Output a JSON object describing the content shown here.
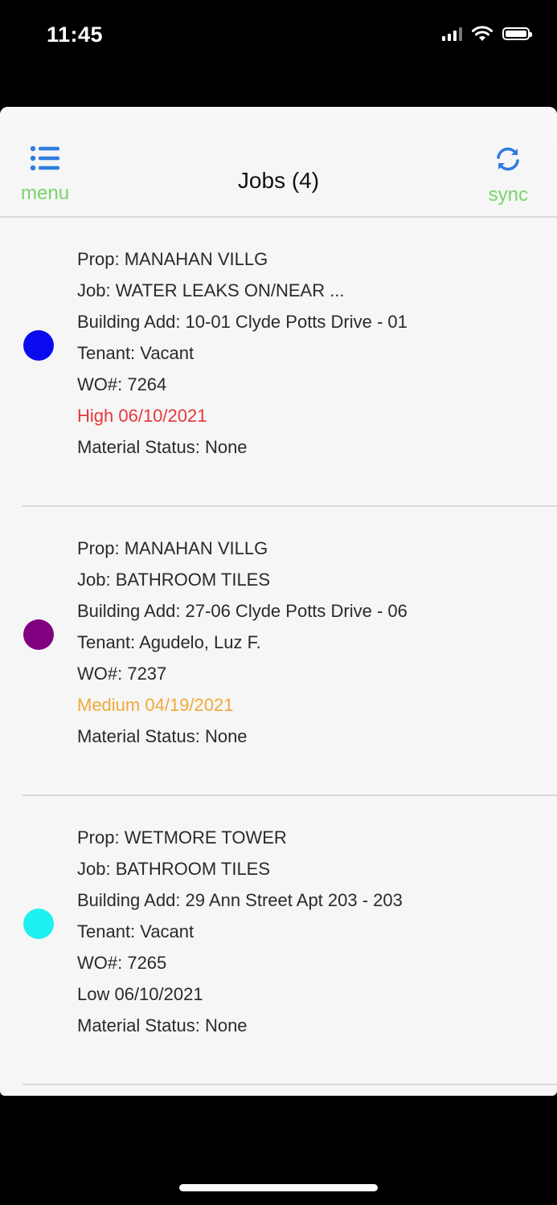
{
  "status_bar": {
    "time": "11:45"
  },
  "navbar": {
    "title": "Jobs (4)",
    "menu_label": "menu",
    "sync_label": "sync",
    "accent_color": "#2f7ce0",
    "label_color": "#78d46a"
  },
  "jobs": [
    {
      "dot_color": "#0a0aef",
      "prop": "Prop: MANAHAN VILLG",
      "job": "Job: WATER LEAKS ON/NEAR ...",
      "building": "Building Add: 10-01 Clyde Potts Drive - 01",
      "tenant": "Tenant: Vacant",
      "wo": "WO#: 7264",
      "priority": "High 06/10/2021",
      "priority_color": "#e8373c",
      "material": "Material Status: None"
    },
    {
      "dot_color": "#800080",
      "prop": "Prop: MANAHAN VILLG",
      "job": "Job: BATHROOM TILES",
      "building": "Building Add: 27-06 Clyde Potts Drive - 06",
      "tenant": "Tenant: Agudelo, Luz F.",
      "wo": "WO#: 7237",
      "priority": "Medium 04/19/2021",
      "priority_color": "#f0a93a",
      "material": "Material Status: None"
    },
    {
      "dot_color": "#1ef0f0",
      "prop": "Prop: WETMORE TOWER",
      "job": "Job: BATHROOM TILES",
      "building": "Building Add: 29 Ann Street Apt 203 - 203",
      "tenant": "Tenant: Vacant",
      "wo": "WO#: 7265",
      "priority": "Low 06/10/2021",
      "priority_color": "#2a2a2a",
      "material": "Material Status: None"
    }
  ]
}
